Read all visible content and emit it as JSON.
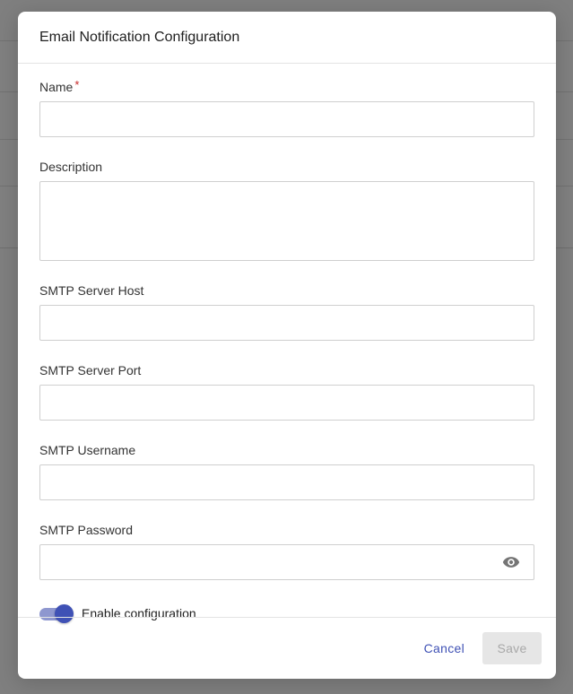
{
  "modal": {
    "title": "Email Notification Configuration"
  },
  "form": {
    "name": {
      "label": "Name",
      "required_mark": "*",
      "value": ""
    },
    "description": {
      "label": "Description",
      "value": ""
    },
    "smtp_host": {
      "label": "SMTP Server Host",
      "value": ""
    },
    "smtp_port": {
      "label": "SMTP Server Port",
      "value": ""
    },
    "smtp_username": {
      "label": "SMTP Username",
      "value": ""
    },
    "smtp_password": {
      "label": "SMTP Password",
      "value": ""
    },
    "enable": {
      "label": "Enable configuration",
      "checked": true
    }
  },
  "footer": {
    "cancel_label": "Cancel",
    "save_label": "Save"
  },
  "icons": {
    "password_visibility": "eye-icon"
  },
  "colors": {
    "accent": "#3f51b5",
    "required": "#c62828",
    "disabled_text": "#a8a8a8",
    "disabled_bg": "#e6e6e6"
  }
}
